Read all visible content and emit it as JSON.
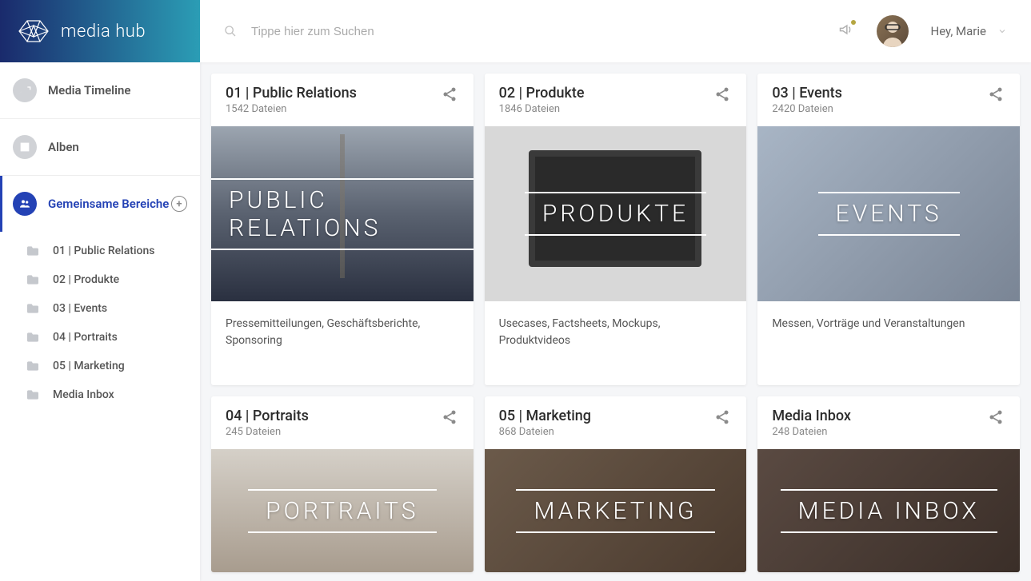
{
  "brand": "media hub",
  "search": {
    "placeholder": "Tippe hier zum Suchen"
  },
  "user": {
    "greeting": "Hey, Marie"
  },
  "nav": {
    "timeline": "Media Timeline",
    "albums": "Alben",
    "shared": "Gemeinsame Bereiche",
    "items": [
      {
        "label": "01 | Public Relations"
      },
      {
        "label": "02 | Produkte"
      },
      {
        "label": "03 | Events"
      },
      {
        "label": "04 | Portraits"
      },
      {
        "label": "05 | Marketing"
      },
      {
        "label": "Media Inbox"
      }
    ]
  },
  "cards": [
    {
      "title": "01 | Public Relations",
      "files": "1542 Dateien",
      "overlay": "PUBLIC RELATIONS",
      "desc": "Pressemitteilungen, Geschäftsberichte, Sponsoring",
      "bg": "bg-pr"
    },
    {
      "title": "02 | Produkte",
      "files": "1846 Dateien",
      "overlay": "PRODUKTE",
      "desc": "Usecases, Factsheets, Mockups, Produktvideos",
      "bg": "bg-prod"
    },
    {
      "title": "03 | Events",
      "files": "2420 Dateien",
      "overlay": "EVENTS",
      "desc": "Messen, Vorträge und Veranstaltungen",
      "bg": "bg-events"
    },
    {
      "title": "04 | Portraits",
      "files": "245 Dateien",
      "overlay": "PORTRAITS",
      "desc": "",
      "bg": "bg-portrait"
    },
    {
      "title": "05 | Marketing",
      "files": "868 Dateien",
      "overlay": "MARKETING",
      "desc": "",
      "bg": "bg-marketing"
    },
    {
      "title": "Media Inbox",
      "files": "248 Dateien",
      "overlay": "MEDIA INBOX",
      "desc": "",
      "bg": "bg-inbox"
    }
  ]
}
